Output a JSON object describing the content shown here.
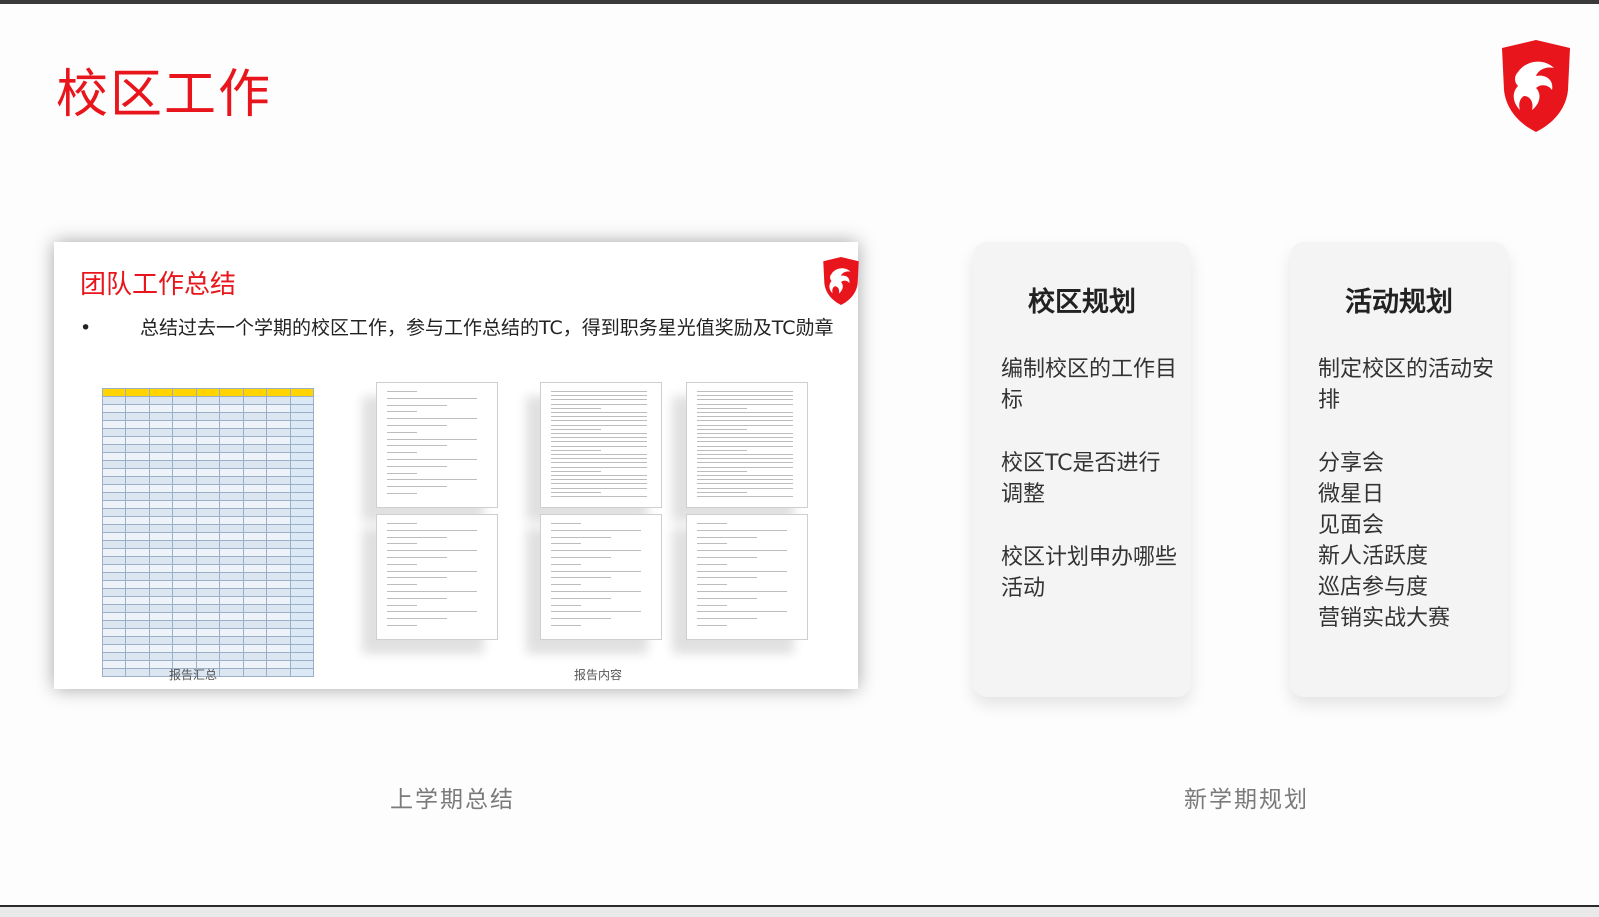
{
  "page": {
    "title": "校区工作",
    "accent_color": "#e8161c"
  },
  "slide": {
    "title": "团队工作总结",
    "bullet_symbol": "•",
    "bullet_text": "总结过去一个学期的校区工作，参与工作总结的TC，得到职务星光值奖励及TC勋章",
    "caption_summary": "报告汇总",
    "caption_content": "报告内容"
  },
  "cards": [
    {
      "title": "校区规划",
      "items": [
        "编制校区的工作目标",
        "校区TC是否进行调整",
        "校区计划申办哪些活动"
      ]
    },
    {
      "title": "活动规划",
      "items": [
        "制定校区的活动安排",
        "分享会",
        "微星日",
        "见面会",
        "新人活跃度",
        "巡店参与度",
        "营销实战大赛"
      ]
    }
  ],
  "labels": {
    "left_section": "上学期总结",
    "right_section": "新学期规划"
  },
  "icons": {
    "logo": "msi-dragon-shield-icon"
  }
}
